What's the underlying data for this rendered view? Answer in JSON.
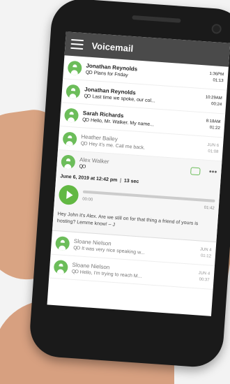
{
  "app": {
    "title": "Voicemail"
  },
  "voicemails": [
    {
      "name": "Jonathan Reynolds",
      "message": "Plans for Friday",
      "time": "1:36PM",
      "duration": "01:13",
      "read": false
    },
    {
      "name": "Jonathan Reynolds",
      "message": "Last time we spoke, our col...",
      "time": "10:29AM",
      "duration": "00:24",
      "read": false
    },
    {
      "name": "Sarah Richards",
      "message": "Hello, Mr. Walker. My name...",
      "time": "8:18AM",
      "duration": "01:22",
      "read": false
    },
    {
      "name": "Heather Bailey",
      "message": "Hey it's me. Call me back.",
      "time": "JUN 6",
      "duration": "01:08",
      "read": true
    }
  ],
  "expanded": {
    "name": "Alex Walker",
    "date": "June 6, 2019 at 12:42 pm",
    "duration": "13 sec",
    "elapsed": "00:00",
    "total": "01:42",
    "progress": 0,
    "transcript": "Hey John it's Alex. Are we still on for that thing a friend of yours is hosting? Lemme know! – J"
  },
  "older": [
    {
      "name": "Sloane Nielson",
      "message": "It was very nice speaking w...",
      "time": "JUN 4",
      "duration": "01:12"
    },
    {
      "name": "Sloane Nielson",
      "message": "Hello, I'm trying to reach M...",
      "time": "JUN 4",
      "duration": "00:37"
    }
  ],
  "icons": {
    "voicemail": "voicemail-icon",
    "play": "play-icon",
    "chat": "chat-icon",
    "more": "more-icon"
  },
  "colors": {
    "accent": "#62b843",
    "appbar": "#4a4a4a"
  }
}
